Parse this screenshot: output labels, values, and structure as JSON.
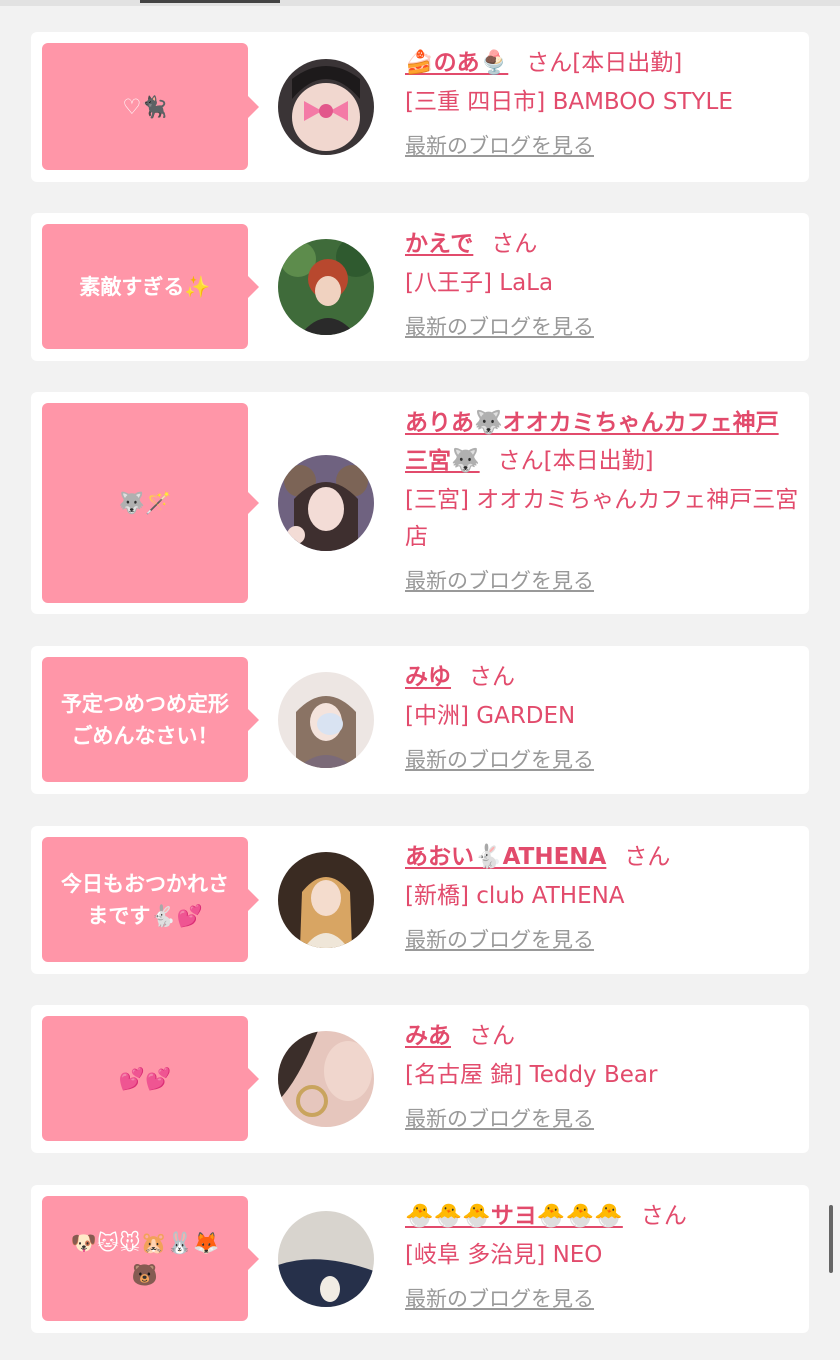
{
  "cards": [
    {
      "message": "♡🐈‍⬛",
      "name": "🍰のあ🍨",
      "san": "さん",
      "status": "[本日出勤]",
      "shop": "[三重 四日市] BAMBOO STYLE",
      "blog_link": "最新のブログを見る"
    },
    {
      "message": "素敵すぎる✨",
      "name": "かえで",
      "san": "さん",
      "status": "",
      "shop": "[八王子] LaLa",
      "blog_link": "最新のブログを見る"
    },
    {
      "message": "🐺🪄",
      "name": "ありあ🐺オオカミちゃんカフェ神戸三宮🐺",
      "san": "さん",
      "status": "[本日出勤]",
      "shop": "[三宮] オオカミちゃんカフェ神戸三宮店",
      "blog_link": "最新のブログを見る"
    },
    {
      "message": "予定つめつめ定形\nごめんなさい！",
      "name": "みゆ",
      "san": "さん",
      "status": "",
      "shop": "[中洲] GARDEN",
      "blog_link": "最新のブログを見る"
    },
    {
      "message": "今日もおつかれさ\nまです🐇💕",
      "name": "あおい🐇ATHENA",
      "san": "さん",
      "status": "",
      "shop": "[新橋] club ATHENA",
      "blog_link": "最新のブログを見る"
    },
    {
      "message": "💕💕",
      "name": "みあ",
      "san": "さん",
      "status": "",
      "shop": "[名古屋 錦] Teddy Bear",
      "blog_link": "最新のブログを見る"
    },
    {
      "message": "🐶🐱🐭🐹🐰🦊\n🐻",
      "name": "🐣🐣🐣サヨ🐣🐣🐣",
      "san": "さん",
      "status": "",
      "shop": "[岐阜 多治見] NEO",
      "blog_link": "最新のブログを見る"
    }
  ]
}
